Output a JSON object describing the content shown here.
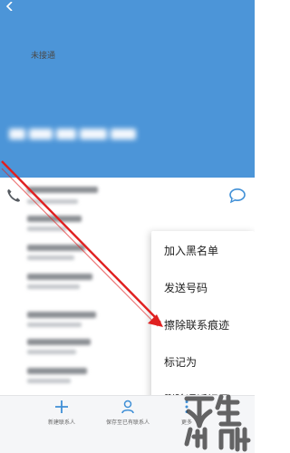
{
  "menu": {
    "items": [
      {
        "label": "加入黑名单"
      },
      {
        "label": "发送号码"
      },
      {
        "label": "擦除联系痕迹"
      },
      {
        "label": "标记为"
      },
      {
        "label": "删除通话记录"
      }
    ]
  },
  "bottom_bar": {
    "new_contact": "新建联系人",
    "save_existing": "保存至已有联系人",
    "more": "更多"
  },
  "watermark": {
    "text": "未接通"
  },
  "colors": {
    "header": "#4c95d8",
    "annotation_arrow": "#e02020",
    "accent_icon": "#3f8fd6"
  },
  "icons": {
    "back": "back-arrow-icon",
    "call": "phone-icon",
    "message": "message-bubble-icon",
    "add": "plus-icon",
    "person": "person-icon",
    "more": "more-dots-icon"
  }
}
